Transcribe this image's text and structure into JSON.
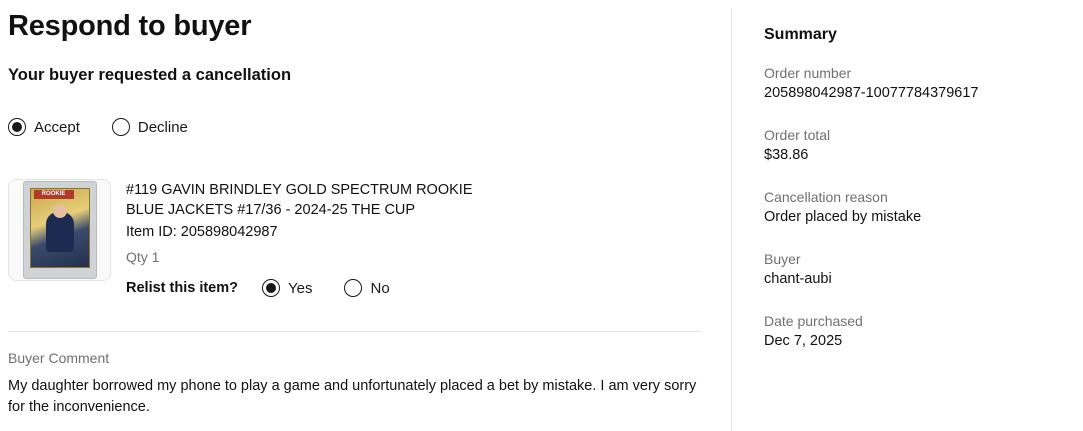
{
  "page": {
    "title": "Respond to buyer",
    "subtitle": "Your buyer requested a cancellation"
  },
  "response": {
    "options": [
      {
        "label": "Accept",
        "checked": true
      },
      {
        "label": "Decline",
        "checked": false
      }
    ]
  },
  "item": {
    "title_line1": "#119 GAVIN BRINDLEY GOLD SPECTRUM ROOKIE",
    "title_line2": "BLUE JACKETS #17/36 - 2024-25 THE CUP",
    "item_id": "Item ID: 205898042987",
    "qty": "Qty 1",
    "thumbnail_banner": "ROOKIE",
    "relist": {
      "label": "Relist this item?",
      "options": [
        {
          "label": "Yes",
          "checked": true
        },
        {
          "label": "No",
          "checked": false
        }
      ]
    }
  },
  "comment": {
    "label": "Buyer Comment",
    "text": "My daughter borrowed my phone to play a game and unfortunately placed a bet by mistake. I am very sorry for the inconvenience."
  },
  "summary": {
    "title": "Summary",
    "fields": [
      {
        "label": "Order number",
        "value": "205898042987-10077784379617"
      },
      {
        "label": "Order total",
        "value": "$38.86"
      },
      {
        "label": "Cancellation reason",
        "value": "Order placed by mistake"
      },
      {
        "label": "Buyer",
        "value": "chant-aubi"
      },
      {
        "label": "Date purchased",
        "value": "Dec 7, 2025"
      }
    ]
  },
  "colors": {
    "text": "#111111",
    "muted": "#707070",
    "divider": "#e5e5e5"
  }
}
